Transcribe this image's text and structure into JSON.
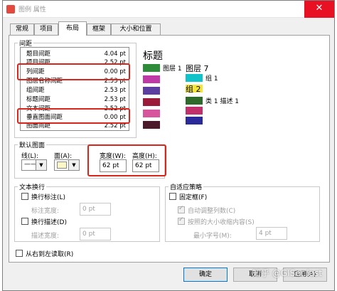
{
  "window": {
    "title": "图例 属性",
    "close": "✕"
  },
  "tabs": [
    {
      "label": "常规"
    },
    {
      "label": "项目"
    },
    {
      "label": "布局"
    },
    {
      "label": "框架"
    },
    {
      "label": "大小和位置"
    }
  ],
  "active_tab": "布局",
  "spacing": {
    "group_label": "间距",
    "rows": [
      {
        "name": "题目间距",
        "value": "4.04 pt"
      },
      {
        "name": "项目间距",
        "value": "2.52 pt"
      },
      {
        "name": "列间距",
        "value": "0.00 pt"
      },
      {
        "name": "图层名称间距",
        "value": "2.53 pt"
      },
      {
        "name": "组间距",
        "value": "2.53 pt"
      },
      {
        "name": "标题间距",
        "value": "2.53 pt"
      },
      {
        "name": "文本间距",
        "value": "2.52 pt"
      },
      {
        "name": "垂直图面间距",
        "value": "0.00 pt"
      },
      {
        "name": "图面间距",
        "value": "2.52 pt"
      }
    ]
  },
  "preview": {
    "title": "标题",
    "layer1": "图层 1",
    "layer7": "图层 7",
    "group1": "组 1",
    "group2": "组 2",
    "class1": "类 1 描述 1",
    "col1_colors": [
      "#2e8b3a",
      "#c03aa7",
      "#5b3ea0",
      "#9a1b3a",
      "#d6559c",
      "#4a1a2a"
    ],
    "col2_colors": [
      "#11c2c9",
      "#f4e53a",
      "#2e6b2a",
      "#c0306a",
      "#2a2a9a"
    ]
  },
  "default_patch": {
    "group_label": "默认图面",
    "line_label": "线(L):",
    "fill_label": "面(A):",
    "line_value": "——",
    "fill_color": "#fbf7c7",
    "width_label": "宽度(W):",
    "width_value": "62 pt",
    "height_label": "高度(H):",
    "height_value": "62 pt"
  },
  "text_wrap": {
    "group_label": "文本换行",
    "wrap_labels": "换行标注(L)",
    "label_width_label": "标注宽度:",
    "label_width_value": "0 pt",
    "wrap_desc": "换行描述(D)",
    "desc_width_label": "描述宽度:",
    "desc_width_value": "0 pt"
  },
  "fitting": {
    "group_label": "自适应策略",
    "fixed_frame": "固定框(F)",
    "auto_columns": "自动调整列数(C)",
    "shrink": "按照的大小收缩内容(S)",
    "min_font_label": "最小字号(M):",
    "min_font_value": "4 pt"
  },
  "right_to_left": "从右到左读取(R)",
  "buttons": {
    "ok": "确定",
    "cancel": "取消",
    "apply": "应用(A)"
  },
  "watermark": "知乎 @GISer last"
}
